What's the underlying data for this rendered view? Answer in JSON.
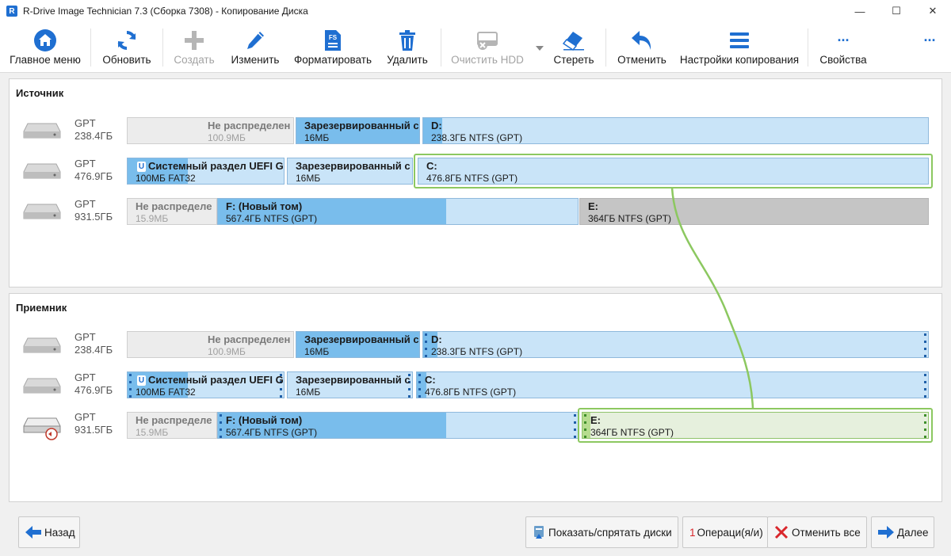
{
  "window": {
    "title": "R-Drive Image Technician 7.3 (Сборка 7308) - Копирование Диска",
    "logo": "R",
    "min_glyph": "—",
    "max_glyph": "☐",
    "close_glyph": "✕"
  },
  "toolbar": {
    "home": "Главное меню",
    "refresh": "Обновить",
    "create": "Создать",
    "edit": "Изменить",
    "format": "Форматировать",
    "format_badge": "FS",
    "delete": "Удалить",
    "wipe_hdd": "Очистить HDD",
    "erase": "Стереть",
    "undo": "Отменить",
    "copy_settings": "Настройки копирования",
    "properties": "Свойства",
    "more": "···"
  },
  "source": {
    "title": "Источник",
    "disks": [
      {
        "type": "GPT",
        "size": "238.4ГБ",
        "parts": [
          {
            "name": "Не распределен",
            "info": "100.9МБ"
          },
          {
            "name": "Зарезервированный с",
            "info": "16МБ"
          },
          {
            "name": "D:",
            "info": "238.3ГБ NTFS (GPT)"
          }
        ]
      },
      {
        "type": "GPT",
        "size": "476.9ГБ",
        "parts": [
          {
            "name": "Системный раздел UEFI GF",
            "info": "100МБ FAT32",
            "badge": "U"
          },
          {
            "name": "Зарезервированный с",
            "info": "16МБ"
          },
          {
            "name": "C:",
            "info": "476.8ГБ NTFS (GPT)"
          }
        ]
      },
      {
        "type": "GPT",
        "size": "931.5ГБ",
        "parts": [
          {
            "name": "Не распределе",
            "info": "15.9МБ"
          },
          {
            "name": "F: (Новый том)",
            "info": "567.4ГБ NTFS (GPT)"
          },
          {
            "name": "E:",
            "info": "364ГБ NTFS (GPT)"
          }
        ]
      }
    ]
  },
  "target": {
    "title": "Приемник",
    "disks": [
      {
        "type": "GPT",
        "size": "238.4ГБ",
        "parts": [
          {
            "name": "Не распределен",
            "info": "100.9МБ"
          },
          {
            "name": "Зарезервированный с",
            "info": "16МБ"
          },
          {
            "name": "D:",
            "info": "238.3ГБ NTFS (GPT)"
          }
        ]
      },
      {
        "type": "GPT",
        "size": "476.9ГБ",
        "parts": [
          {
            "name": "Системный раздел UEFI G",
            "info": "100МБ FAT32",
            "badge": "U"
          },
          {
            "name": "Зарезервированный с",
            "info": "16МБ"
          },
          {
            "name": "C:",
            "info": "476.8ГБ NTFS (GPT)"
          }
        ]
      },
      {
        "type": "GPT",
        "size": "931.5ГБ",
        "parts": [
          {
            "name": "Не распределе",
            "info": "15.9МБ"
          },
          {
            "name": "F: (Новый том)",
            "info": "567.4ГБ NTFS (GPT)"
          },
          {
            "name": "E:",
            "info": "364ГБ NTFS (GPT)"
          }
        ]
      }
    ]
  },
  "footer": {
    "back": "Назад",
    "show_hide": "Показать/спрятать диски",
    "op_count": "1",
    "ops": "Операци(я/и)",
    "cancel_all": "Отменить все",
    "next": "Далее"
  },
  "colors": {
    "accent": "#1f6fd1",
    "partition": "#c9e4f8",
    "used": "#79bdec",
    "selection": "#8cc860"
  }
}
